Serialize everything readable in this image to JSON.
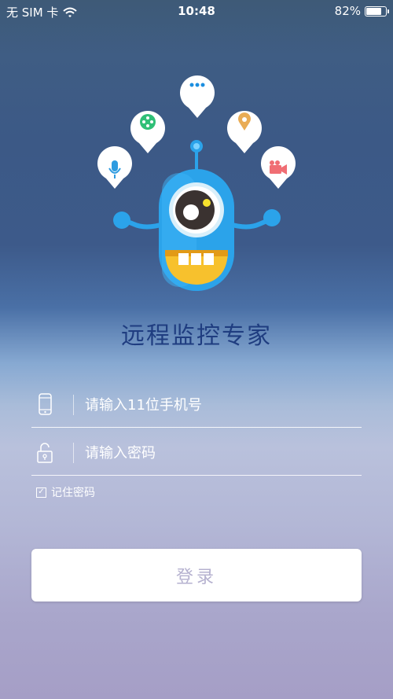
{
  "status_bar": {
    "carrier": "无 SIM 卡",
    "time": "10:48",
    "battery_text": "82%",
    "battery_level": 0.82,
    "wifi_icon": "wifi-icon",
    "battery_icon": "battery-icon"
  },
  "app": {
    "title": "远程监控专家"
  },
  "mascot": {
    "icon": "robot-mascot-icon",
    "bubbles": [
      "microphone-icon",
      "film-reel-icon",
      "chat-dots-icon",
      "location-pin-icon",
      "video-camera-icon"
    ],
    "colors": {
      "body": "#2ba3ea",
      "mouth": "#f7c12d",
      "microphone": "#2e9be0",
      "film": "#2fbf77",
      "dots": "#1c8fe0",
      "pin": "#e9ac55",
      "camera": "#f06e74"
    }
  },
  "form": {
    "phone_placeholder": "请输入11位手机号",
    "password_placeholder": "请输入密码",
    "remember_label": "记住密码",
    "remember_checked": true,
    "phone_icon": "phone-icon",
    "lock_icon": "lock-icon"
  },
  "actions": {
    "login_label": "登录"
  },
  "colors": {
    "title": "#1f3d80",
    "button_text": "#b5b1cf",
    "button_bg": "#ffffff"
  }
}
